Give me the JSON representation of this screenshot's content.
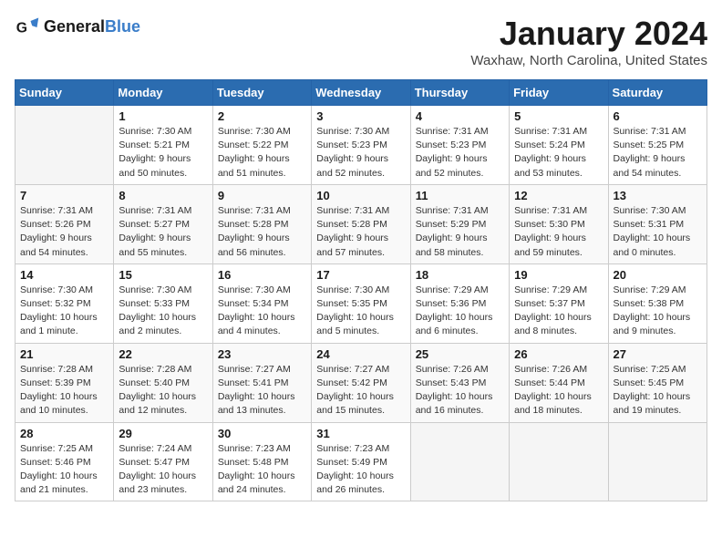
{
  "header": {
    "logo_general": "General",
    "logo_blue": "Blue",
    "month": "January 2024",
    "location": "Waxhaw, North Carolina, United States"
  },
  "weekdays": [
    "Sunday",
    "Monday",
    "Tuesday",
    "Wednesday",
    "Thursday",
    "Friday",
    "Saturday"
  ],
  "weeks": [
    [
      {
        "num": "",
        "info": ""
      },
      {
        "num": "1",
        "info": "Sunrise: 7:30 AM\nSunset: 5:21 PM\nDaylight: 9 hours\nand 50 minutes."
      },
      {
        "num": "2",
        "info": "Sunrise: 7:30 AM\nSunset: 5:22 PM\nDaylight: 9 hours\nand 51 minutes."
      },
      {
        "num": "3",
        "info": "Sunrise: 7:30 AM\nSunset: 5:23 PM\nDaylight: 9 hours\nand 52 minutes."
      },
      {
        "num": "4",
        "info": "Sunrise: 7:31 AM\nSunset: 5:23 PM\nDaylight: 9 hours\nand 52 minutes."
      },
      {
        "num": "5",
        "info": "Sunrise: 7:31 AM\nSunset: 5:24 PM\nDaylight: 9 hours\nand 53 minutes."
      },
      {
        "num": "6",
        "info": "Sunrise: 7:31 AM\nSunset: 5:25 PM\nDaylight: 9 hours\nand 54 minutes."
      }
    ],
    [
      {
        "num": "7",
        "info": "Sunrise: 7:31 AM\nSunset: 5:26 PM\nDaylight: 9 hours\nand 54 minutes."
      },
      {
        "num": "8",
        "info": "Sunrise: 7:31 AM\nSunset: 5:27 PM\nDaylight: 9 hours\nand 55 minutes."
      },
      {
        "num": "9",
        "info": "Sunrise: 7:31 AM\nSunset: 5:28 PM\nDaylight: 9 hours\nand 56 minutes."
      },
      {
        "num": "10",
        "info": "Sunrise: 7:31 AM\nSunset: 5:28 PM\nDaylight: 9 hours\nand 57 minutes."
      },
      {
        "num": "11",
        "info": "Sunrise: 7:31 AM\nSunset: 5:29 PM\nDaylight: 9 hours\nand 58 minutes."
      },
      {
        "num": "12",
        "info": "Sunrise: 7:31 AM\nSunset: 5:30 PM\nDaylight: 9 hours\nand 59 minutes."
      },
      {
        "num": "13",
        "info": "Sunrise: 7:30 AM\nSunset: 5:31 PM\nDaylight: 10 hours\nand 0 minutes."
      }
    ],
    [
      {
        "num": "14",
        "info": "Sunrise: 7:30 AM\nSunset: 5:32 PM\nDaylight: 10 hours\nand 1 minute."
      },
      {
        "num": "15",
        "info": "Sunrise: 7:30 AM\nSunset: 5:33 PM\nDaylight: 10 hours\nand 2 minutes."
      },
      {
        "num": "16",
        "info": "Sunrise: 7:30 AM\nSunset: 5:34 PM\nDaylight: 10 hours\nand 4 minutes."
      },
      {
        "num": "17",
        "info": "Sunrise: 7:30 AM\nSunset: 5:35 PM\nDaylight: 10 hours\nand 5 minutes."
      },
      {
        "num": "18",
        "info": "Sunrise: 7:29 AM\nSunset: 5:36 PM\nDaylight: 10 hours\nand 6 minutes."
      },
      {
        "num": "19",
        "info": "Sunrise: 7:29 AM\nSunset: 5:37 PM\nDaylight: 10 hours\nand 8 minutes."
      },
      {
        "num": "20",
        "info": "Sunrise: 7:29 AM\nSunset: 5:38 PM\nDaylight: 10 hours\nand 9 minutes."
      }
    ],
    [
      {
        "num": "21",
        "info": "Sunrise: 7:28 AM\nSunset: 5:39 PM\nDaylight: 10 hours\nand 10 minutes."
      },
      {
        "num": "22",
        "info": "Sunrise: 7:28 AM\nSunset: 5:40 PM\nDaylight: 10 hours\nand 12 minutes."
      },
      {
        "num": "23",
        "info": "Sunrise: 7:27 AM\nSunset: 5:41 PM\nDaylight: 10 hours\nand 13 minutes."
      },
      {
        "num": "24",
        "info": "Sunrise: 7:27 AM\nSunset: 5:42 PM\nDaylight: 10 hours\nand 15 minutes."
      },
      {
        "num": "25",
        "info": "Sunrise: 7:26 AM\nSunset: 5:43 PM\nDaylight: 10 hours\nand 16 minutes."
      },
      {
        "num": "26",
        "info": "Sunrise: 7:26 AM\nSunset: 5:44 PM\nDaylight: 10 hours\nand 18 minutes."
      },
      {
        "num": "27",
        "info": "Sunrise: 7:25 AM\nSunset: 5:45 PM\nDaylight: 10 hours\nand 19 minutes."
      }
    ],
    [
      {
        "num": "28",
        "info": "Sunrise: 7:25 AM\nSunset: 5:46 PM\nDaylight: 10 hours\nand 21 minutes."
      },
      {
        "num": "29",
        "info": "Sunrise: 7:24 AM\nSunset: 5:47 PM\nDaylight: 10 hours\nand 23 minutes."
      },
      {
        "num": "30",
        "info": "Sunrise: 7:23 AM\nSunset: 5:48 PM\nDaylight: 10 hours\nand 24 minutes."
      },
      {
        "num": "31",
        "info": "Sunrise: 7:23 AM\nSunset: 5:49 PM\nDaylight: 10 hours\nand 26 minutes."
      },
      {
        "num": "",
        "info": ""
      },
      {
        "num": "",
        "info": ""
      },
      {
        "num": "",
        "info": ""
      }
    ]
  ]
}
